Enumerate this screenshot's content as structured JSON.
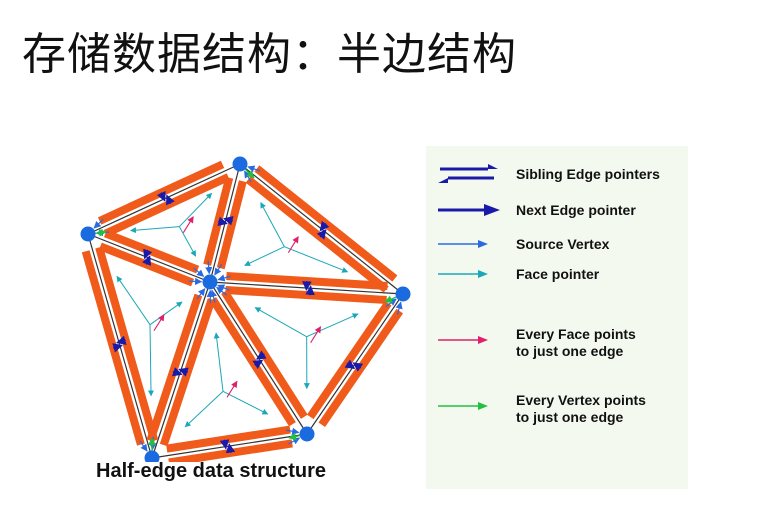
{
  "slide": {
    "title": "存储数据结构：半边结构"
  },
  "figure": {
    "caption": "Half-edge data structure"
  },
  "legend": {
    "items": [
      {
        "label": "Sibling Edge pointers",
        "symbol": "sibling-edge-arrows-icon",
        "color": "#1a1aa8"
      },
      {
        "label": "Next Edge pointer",
        "symbol": "next-edge-arrow-icon",
        "color": "#1a1aa8"
      },
      {
        "label": "Source Vertex",
        "symbol": "source-vertex-arrow-icon",
        "color": "#2a6ae0"
      },
      {
        "label": "Face pointer",
        "symbol": "face-pointer-arrow-icon",
        "color": "#1aa8b8"
      },
      {
        "label": "Every Face points\nto just one edge",
        "symbol": "face-edge-arrow-icon",
        "color": "#e0206a"
      },
      {
        "label": "Every Vertex points\nto just one edge",
        "symbol": "vertex-edge-arrow-icon",
        "color": "#22c040"
      }
    ]
  },
  "colors": {
    "half_edge": "#f05a1a",
    "vertex": "#1a6ae0",
    "outline": "#333333",
    "legend_background": "#f4f9f0"
  }
}
